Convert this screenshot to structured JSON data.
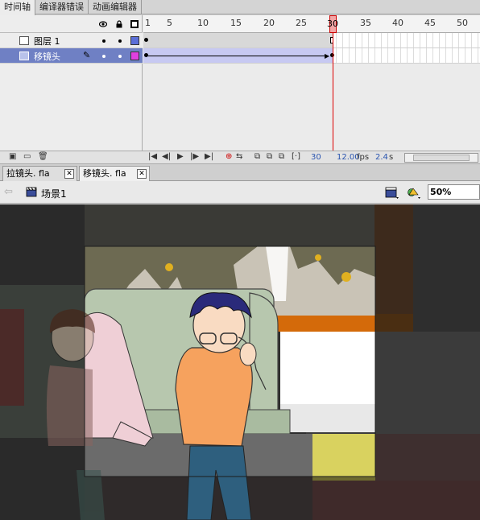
{
  "panel_tabs": [
    "时间轴",
    "编译器错误",
    "动画编辑器"
  ],
  "layers": [
    {
      "name": "图层 1",
      "selected": false,
      "outline_color": "#5b6fd8"
    },
    {
      "name": "移镜头",
      "selected": true,
      "outline_color": "#e040e0"
    }
  ],
  "ruler_numbers": [
    "1",
    "5",
    "10",
    "15",
    "20",
    "25",
    "30",
    "35",
    "40",
    "45",
    "50"
  ],
  "current_frame": "30",
  "frame_rate": "12.00",
  "frame_rate_unit": "fps",
  "elapsed_time": "2.4",
  "elapsed_unit": "s",
  "doc_tabs": [
    {
      "label": "拉镜头. fla",
      "active": false
    },
    {
      "label": "移镜头. fla",
      "active": true
    }
  ],
  "scene_label": "场景1",
  "zoom": "50%",
  "colors": {
    "layer_selected": "#6f80c4",
    "tween_span": "#c7c9f2",
    "playhead": "#dd0000"
  }
}
